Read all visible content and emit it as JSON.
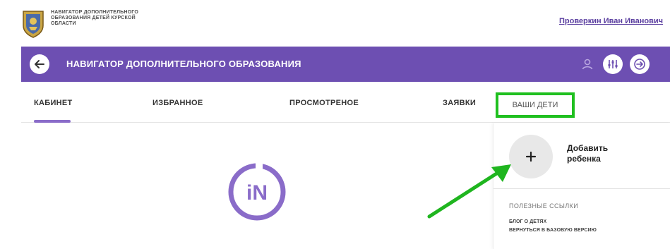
{
  "header": {
    "site_name_lines": [
      "НАВИГАТОР ДОПОЛНИТЕЛЬНОГО",
      "ОБРАЗОВАНИЯ ДЕТЕЙ КУРСКОЙ",
      "ОБЛАСТИ"
    ],
    "user_name": "Проверкин Иван Иванович"
  },
  "bar": {
    "title": "НАВИГАТОР ДОПОЛНИТЕЛЬНОГО ОБРАЗОВАНИЯ",
    "icons": [
      "arrow-left-icon",
      "person-icon",
      "filter-sliders-icon",
      "logout-icon"
    ]
  },
  "tabs": [
    {
      "label": "КАБИНЕТ",
      "active": true
    },
    {
      "label": "ИЗБРАННОЕ",
      "active": false
    },
    {
      "label": "ПРОСМОТРЕНОЕ",
      "active": false
    },
    {
      "label": "ЗАЯВКИ",
      "active": false
    },
    {
      "label": "ВАШИ ДЕТИ",
      "active": false,
      "highlighted": true
    }
  ],
  "main": {
    "logo_text": "iN"
  },
  "sidebar": {
    "add_child_label_line1": "Добавить",
    "add_child_label_line2": "ребенка",
    "useful_links_title": "ПОЛЕЗНЫЕ ССЫЛКИ",
    "links": [
      "БЛОГ О ДЕТЯХ",
      "ВЕРНУТЬСЯ В БАЗОВУЮ ВЕРСИЮ"
    ]
  },
  "colors": {
    "brand_purple": "#6d4fb2",
    "tab_underline": "#8a6cc9",
    "highlight_green": "#20c020",
    "arrow_green": "#1fb51f"
  }
}
